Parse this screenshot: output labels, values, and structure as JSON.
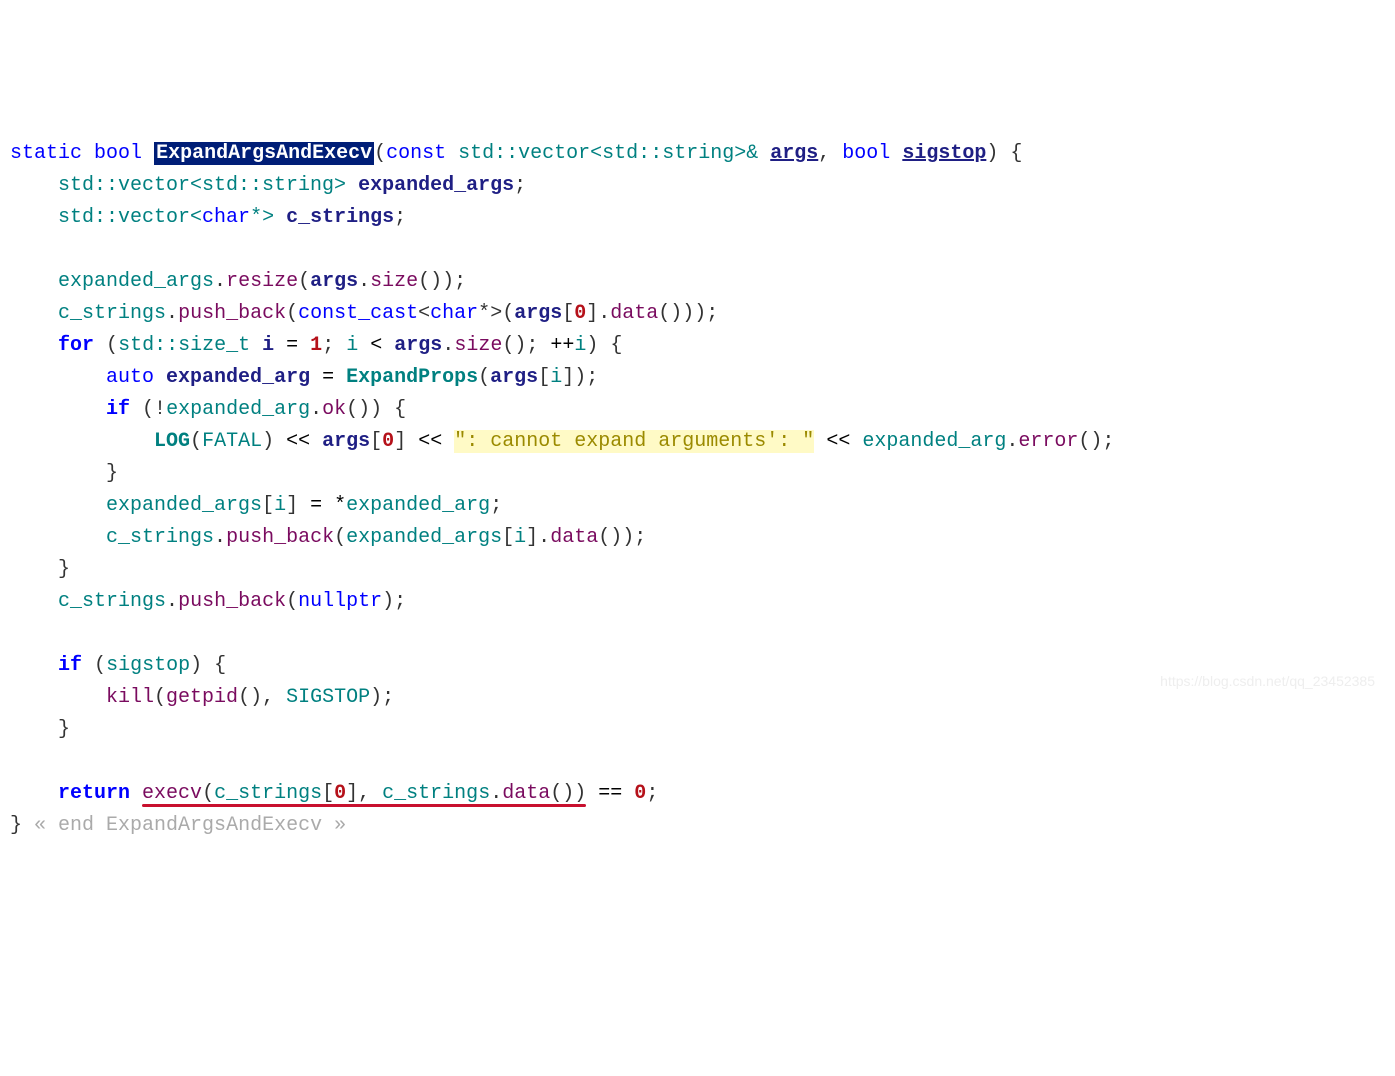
{
  "line1": {
    "static": "static",
    "bool": "bool",
    "fname": "ExpandArgsAndExecv",
    "const_kw": "const",
    "vec1": "std::vector<std::string>&",
    "p1": "args",
    "bool2": "bool",
    "p2": "sigstop"
  },
  "line2": {
    "vec": "std::vector<std::string>",
    "var": "expanded_args"
  },
  "line3": {
    "vec": "std::vector<",
    "char": "char",
    "star": "*>",
    "var": "c_strings"
  },
  "line5": {
    "ea": "expanded_args",
    "resize": "resize",
    "args": "args",
    "size": "size"
  },
  "line6": {
    "cs": "c_strings",
    "push": "push_back",
    "cc": "const_cast",
    "char": "char",
    "star": "*",
    "args": "args",
    "zero": "0",
    "data": "data"
  },
  "line7": {
    "for_kw": "for",
    "sizet": "std::size_t",
    "i": "i",
    "one": "1",
    "args": "args",
    "size": "size"
  },
  "line8": {
    "auto_kw": "auto",
    "ea": "expanded_arg",
    "EP": "ExpandProps",
    "args": "args",
    "i": "i"
  },
  "line9": {
    "if_kw": "if",
    "ea": "expanded_arg",
    "ok": "ok"
  },
  "line10": {
    "LOG": "LOG",
    "FATAL": "FATAL",
    "args": "args",
    "zero": "0",
    "str": "\": cannot expand arguments': \"",
    "ea": "expanded_arg",
    "err": "error"
  },
  "line12": {
    "eas": "expanded_args",
    "i": "i",
    "ea": "expanded_arg"
  },
  "line13": {
    "cs": "c_strings",
    "push": "push_back",
    "eas": "expanded_args",
    "i": "i",
    "data": "data"
  },
  "line15": {
    "cs": "c_strings",
    "push": "push_back",
    "np": "nullptr"
  },
  "line17": {
    "if_kw": "if",
    "sigstop": "sigstop"
  },
  "line18": {
    "kill": "kill",
    "getpid": "getpid",
    "SIGSTOP": "SIGSTOP"
  },
  "line21": {
    "return_kw": "return",
    "execv": "execv",
    "cs": "c_strings",
    "zero": "0",
    "data": "data"
  },
  "end": {
    "text": "« end ExpandArgsAndExecv »"
  },
  "watermark": "https://blog.csdn.net/qq_23452385",
  "chart_data": {
    "type": "table",
    "language": "C++",
    "function_name": "ExpandArgsAndExecv",
    "return_type": "bool",
    "storage": "static",
    "parameters": [
      {
        "type": "const std::vector<std::string>&",
        "name": "args"
      },
      {
        "type": "bool",
        "name": "sigstop"
      }
    ],
    "highlighted_token": "ExpandArgsAndExecv",
    "string_literal_highlighted": "\": cannot expand arguments': \"",
    "underlined_expression": "execv(c_strings[0], c_strings.data())"
  }
}
